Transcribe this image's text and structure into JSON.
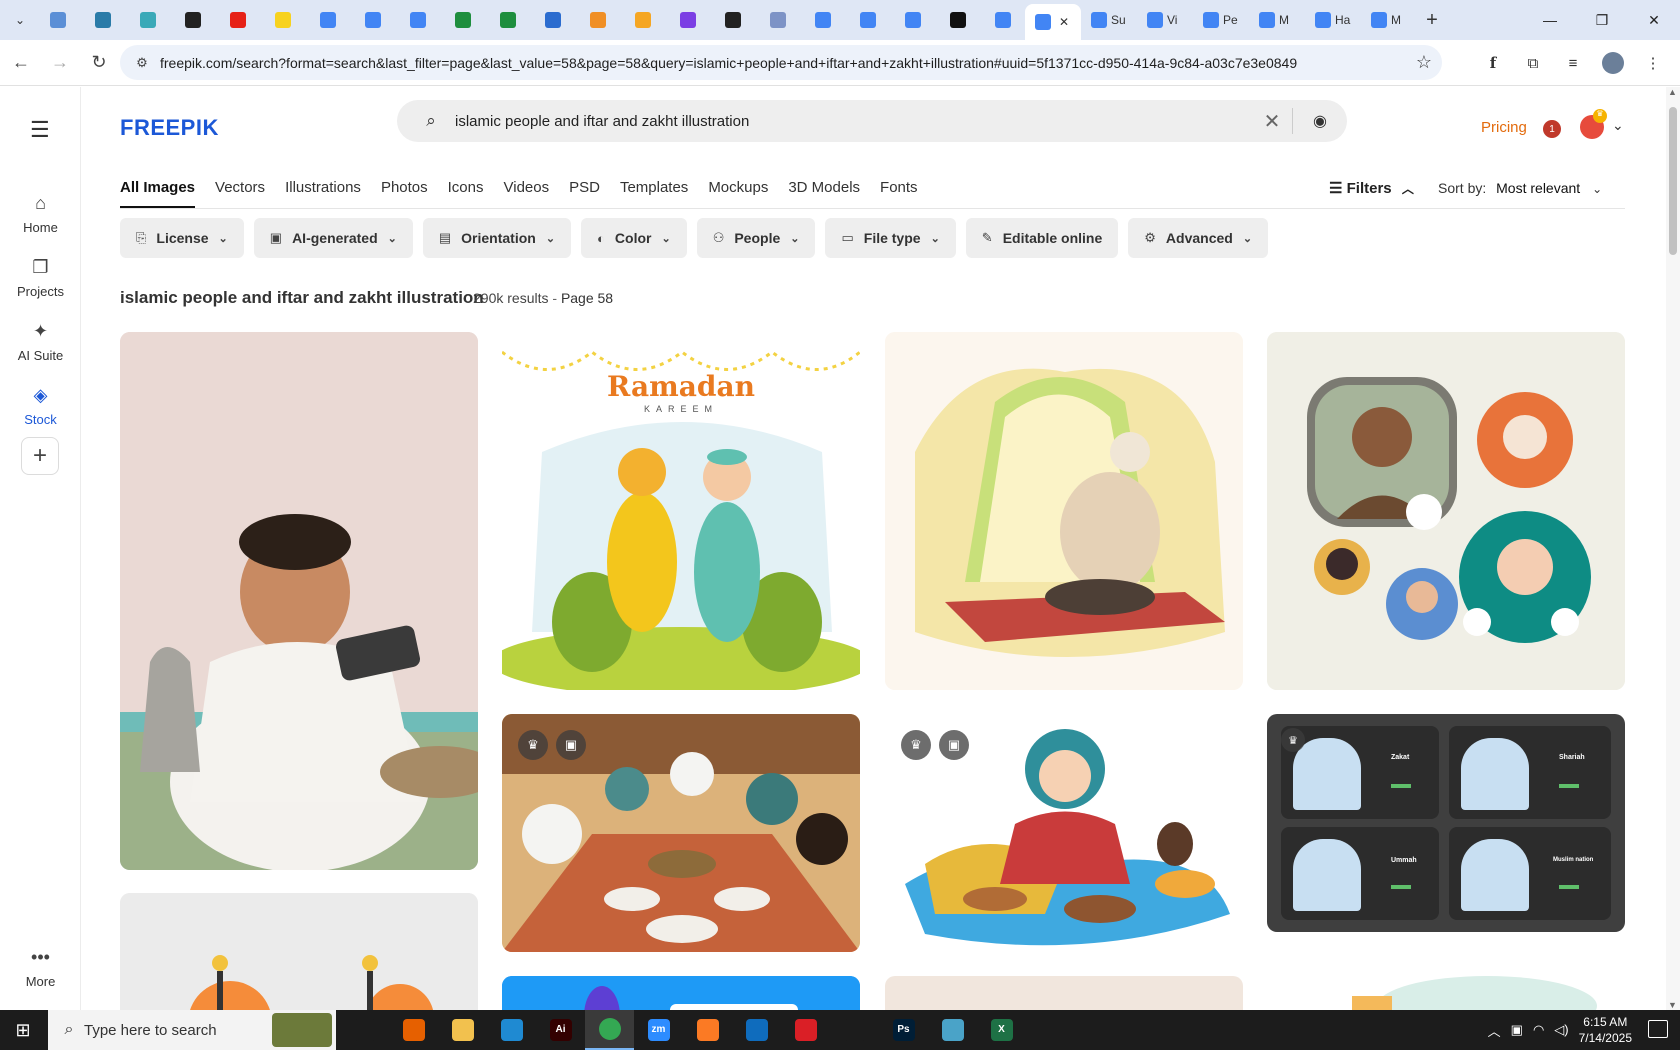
{
  "browser": {
    "tabs": [
      {
        "color": "#5b8fd6"
      },
      {
        "color": "#2a7ba8"
      },
      {
        "color": "#3aa9b8"
      },
      {
        "color": "#222222"
      },
      {
        "color": "#e62117"
      },
      {
        "color": "#f7d21e"
      },
      {
        "color": "#4285f4"
      },
      {
        "color": "#4285f4"
      },
      {
        "color": "#4285f4"
      },
      {
        "color": "#1e8e3e"
      },
      {
        "color": "#1e8e3e"
      },
      {
        "color": "#2b6ccf"
      },
      {
        "color": "#f08f25"
      },
      {
        "color": "#f5a623"
      },
      {
        "color": "#7b3fe4"
      },
      {
        "color": "#222222"
      },
      {
        "color": "#7d93c6"
      },
      {
        "color": "#4285f4"
      },
      {
        "color": "#4285f4"
      },
      {
        "color": "#4285f4"
      },
      {
        "color": "#111111"
      },
      {
        "color": "#4285f4"
      }
    ],
    "labeled_tabs": [
      {
        "label": "Su",
        "color": "#4285f4"
      },
      {
        "label": "Vi",
        "color": "#4285f4"
      },
      {
        "label": "Pe",
        "color": "#4285f4"
      },
      {
        "label": "M",
        "color": "#4285f4"
      },
      {
        "label": "Ha",
        "color": "#4285f4"
      },
      {
        "label": "M",
        "color": "#4285f4"
      }
    ],
    "active_tab_close": "✕",
    "new_tab": "+",
    "url": "freepik.com/search?format=search&last_filter=page&last_value=58&page=58&query=islamic+people+and+iftar+and+zakht+illustration#uuid=5f1371cc-d950-414a-9c84-a03c7e3e0849"
  },
  "site": {
    "logo": "FREEPIK",
    "search_query": "islamic people and iftar and zakht illustration",
    "pricing": "Pricing",
    "notification_count": "1",
    "sidebar": [
      {
        "label": "Home",
        "icon": "home-icon"
      },
      {
        "label": "Projects",
        "icon": "projects-icon"
      },
      {
        "label": "AI Suite",
        "icon": "sparkle-icon"
      },
      {
        "label": "Stock",
        "icon": "stock-icon"
      }
    ],
    "more": "More",
    "categories": [
      "All Images",
      "Vectors",
      "Illustrations",
      "Photos",
      "Icons",
      "Videos",
      "PSD",
      "Templates",
      "Mockups",
      "3D Models",
      "Fonts"
    ],
    "filters_label": "Filters",
    "sort_label": "Sort by:",
    "sort_value": "Most relevant",
    "filter_chips": [
      "License",
      "AI-generated",
      "Orientation",
      "Color",
      "People",
      "File type",
      "Editable online",
      "Advanced"
    ],
    "results_title": "islamic people and iftar and zakht illustration",
    "results_count": "290k results",
    "results_page": "Page 58",
    "zakat_tiles": [
      "Zakat",
      "Shariah",
      "Ummah",
      "Muslim nation"
    ],
    "ramadan_title": "Ramadan",
    "ramadan_sub": "KAREEM"
  },
  "taskbar": {
    "search_placeholder": "Type here to search",
    "time": "6:15 AM",
    "date": "7/14/2025",
    "apps": [
      {
        "icon": "task-view-icon",
        "color": "#1c1c1c",
        "text": ""
      },
      {
        "icon": "firefox-icon",
        "color": "#e66000",
        "text": ""
      },
      {
        "icon": "file-explorer-icon",
        "color": "#f2c14e",
        "text": ""
      },
      {
        "icon": "vscode-icon",
        "color": "#1f8ad2",
        "text": ""
      },
      {
        "icon": "illustrator-icon",
        "color": "#330000",
        "text": "Ai"
      },
      {
        "icon": "chrome-icon",
        "color": "#34a853",
        "text": ""
      },
      {
        "icon": "zoom-icon",
        "color": "#2d8cff",
        "text": "zm"
      },
      {
        "icon": "xampp-icon",
        "color": "#fb7a24",
        "text": ""
      },
      {
        "icon": "outlook-icon",
        "color": "#0f6cbd",
        "text": ""
      },
      {
        "icon": "creative-cloud-icon",
        "color": "#da1f26",
        "text": ""
      },
      {
        "icon": "pen-tool-icon",
        "color": "#1c1c1c",
        "text": ""
      },
      {
        "icon": "photoshop-icon",
        "color": "#001e36",
        "text": "Ps"
      },
      {
        "icon": "app-gem-icon",
        "color": "#4aa3c8",
        "text": ""
      },
      {
        "icon": "excel-icon",
        "color": "#1e7145",
        "text": "X"
      }
    ]
  }
}
